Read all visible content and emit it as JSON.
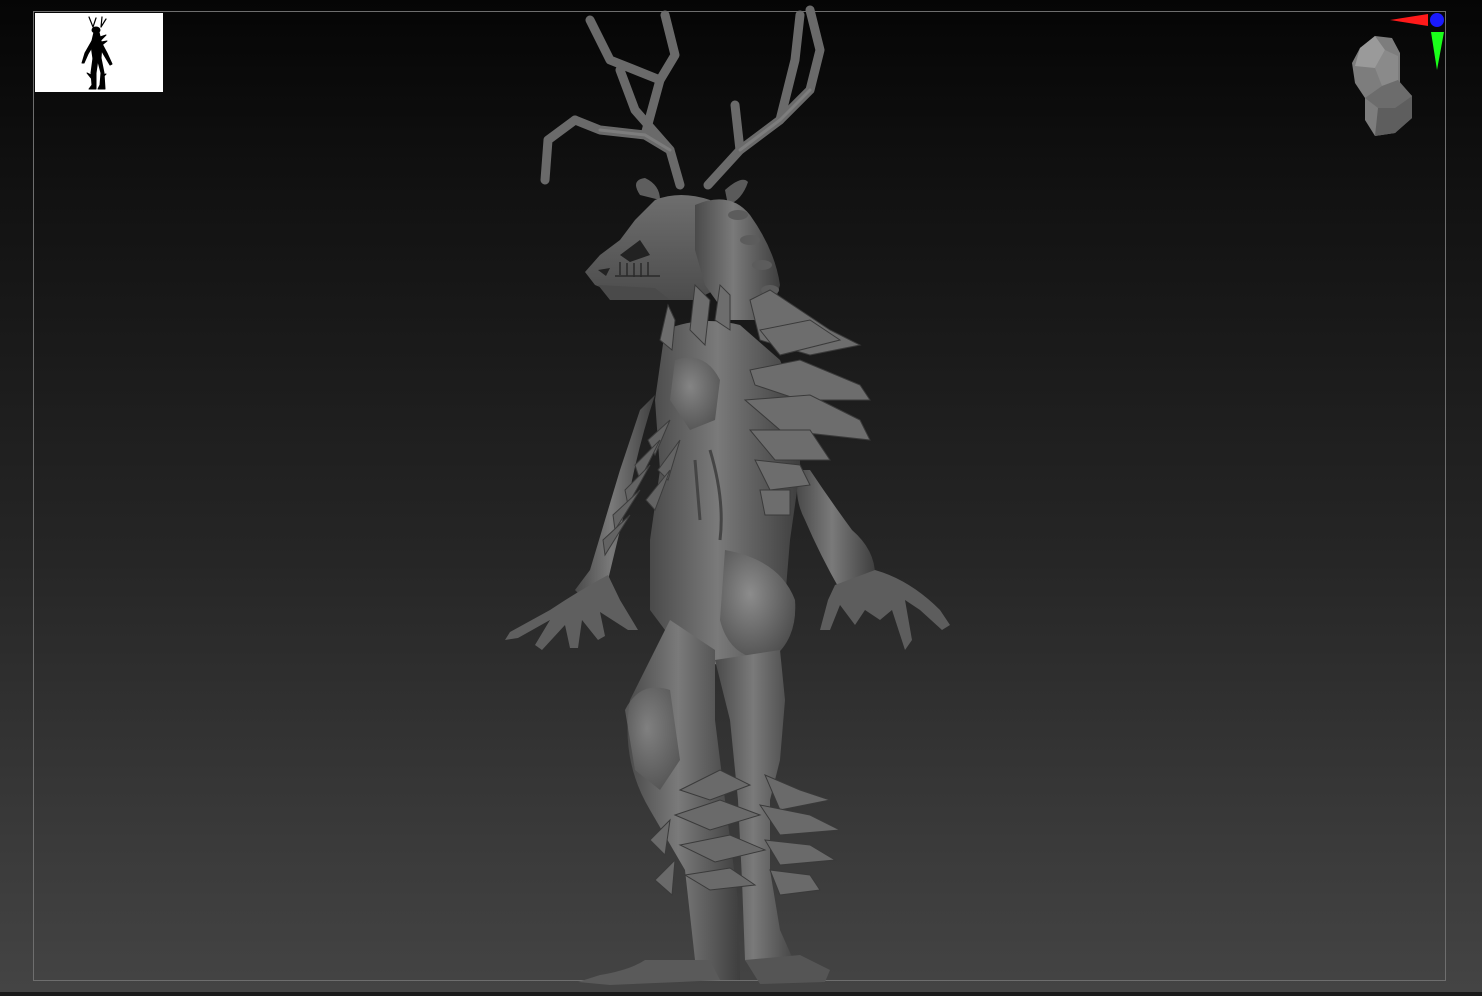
{
  "viewport": {
    "background_top": "#050505",
    "background_bottom": "#444444",
    "frame_color": "#6e6e6e"
  },
  "thumbnail": {
    "background": "#ffffff",
    "silhouette_color": "#000000"
  },
  "model": {
    "subject": "antlered-creature-sculpt",
    "material_color": "#6a6a6a"
  },
  "gizmo": {
    "x_axis_color": "#ff1a1a",
    "y_axis_color": "#1aff1a",
    "z_axis_color": "#1a1aff",
    "head_icon": "head-orientation-icon"
  }
}
